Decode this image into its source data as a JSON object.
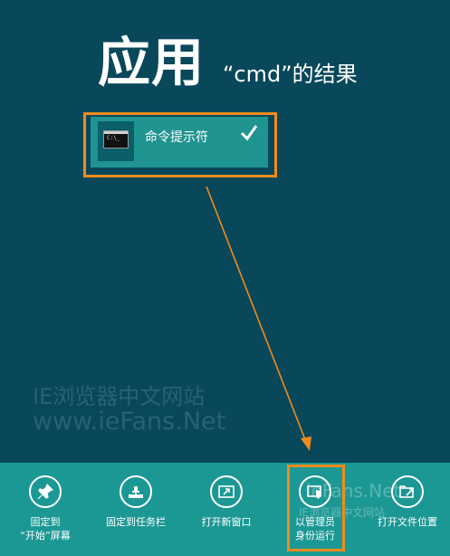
{
  "header": {
    "title": "应用",
    "subtitle": "“cmd”的结果"
  },
  "result": {
    "label": "命令提示符",
    "icon_text": "C:\\_"
  },
  "watermark": {
    "line1": "IE浏览器中文网站",
    "line2": "www.ieFans.Net",
    "line3": "ieFans.Net",
    "line4": "IE浏览器中文网站"
  },
  "app_bar": {
    "buttons": [
      {
        "icon": "pin-icon",
        "label_line1": "固定到",
        "label_line2": "“开始”屏幕"
      },
      {
        "icon": "taskbar-pin-icon",
        "label_line1": "固定到任务栏",
        "label_line2": ""
      },
      {
        "icon": "new-window-icon",
        "label_line1": "打开新窗口",
        "label_line2": ""
      },
      {
        "icon": "admin-shield-icon",
        "label_line1": "以管理员",
        "label_line2": "身份运行"
      },
      {
        "icon": "open-file-location-icon",
        "label_line1": "打开文件位置",
        "label_line2": ""
      }
    ]
  },
  "colors": {
    "background": "#08485a",
    "tile": "#1f9490",
    "app_bar": "#1c9894",
    "highlight": "#f08c1e"
  }
}
